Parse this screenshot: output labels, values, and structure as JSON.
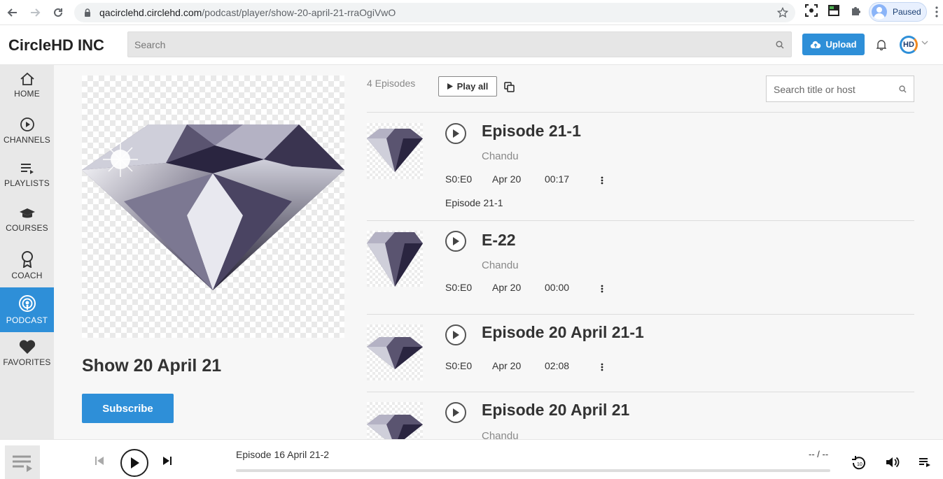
{
  "browser": {
    "url_host": "qacirclehd.circlehd.com",
    "url_path": "/podcast/player/show-20-april-21-rraOgiVwO",
    "profile_label": "Paused"
  },
  "header": {
    "brand": "CircleHD INC",
    "search_placeholder": "Search",
    "upload_label": "Upload",
    "logo_text": "HD"
  },
  "sidebar": {
    "items": [
      {
        "label": "HOME",
        "icon": "home-icon"
      },
      {
        "label": "CHANNELS",
        "icon": "play-circle-icon"
      },
      {
        "label": "PLAYLISTS",
        "icon": "playlist-icon"
      },
      {
        "label": "COURSES",
        "icon": "graduation-cap-icon"
      },
      {
        "label": "COACH",
        "icon": "award-icon"
      },
      {
        "label": "PODCAST",
        "icon": "podcast-icon",
        "active": true
      },
      {
        "label": "FAVORITES",
        "icon": "heart-icon"
      }
    ]
  },
  "show": {
    "title": "Show 20 April 21",
    "subscribe_label": "Subscribe"
  },
  "episodes_header": {
    "count_label": "4 Episodes",
    "play_all_label": "Play all",
    "search_placeholder": "Search title or host"
  },
  "episodes": [
    {
      "title": "Episode 21-1",
      "host": "Chandu",
      "season": "S0:E0",
      "date": "Apr 20",
      "duration": "00:17",
      "description": "Episode 21-1"
    },
    {
      "title": "E-22",
      "host": "Chandu",
      "season": "S0:E0",
      "date": "Apr 20",
      "duration": "00:00",
      "description": ""
    },
    {
      "title": "Episode 20 April 21-1",
      "host": "",
      "season": "S0:E0",
      "date": "Apr 20",
      "duration": "02:08",
      "description": ""
    },
    {
      "title": "Episode 20 April 21",
      "host": "Chandu",
      "season": "",
      "date": "",
      "duration": "",
      "description": ""
    }
  ],
  "player": {
    "now_playing": "Episode 16 April 21-2",
    "time": "-- / --",
    "progress": 0
  },
  "colors": {
    "accent": "#2e8fd8",
    "sidebar_bg": "#e8e8e8"
  }
}
